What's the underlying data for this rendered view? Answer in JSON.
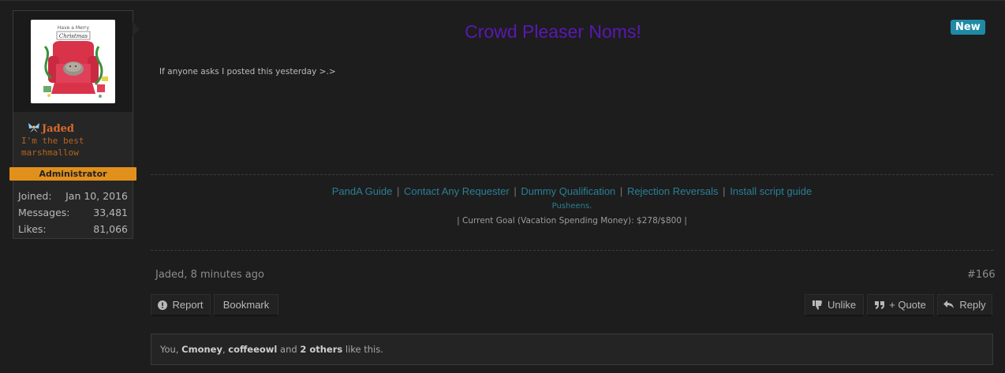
{
  "user": {
    "name": "Jaded",
    "custom_title": "I'm the best marshmallow",
    "role": "Administrator",
    "avatar_text": "Have a Merry Christmas",
    "stats": [
      {
        "label": "Joined:",
        "value": "Jan 10, 2016"
      },
      {
        "label": "Messages:",
        "value": "33,481"
      },
      {
        "label": "Likes:",
        "value": "81,066"
      }
    ]
  },
  "post": {
    "badge": "New",
    "title": "Crowd Pleaser Noms!",
    "body": "If anyone asks I posted this yesterday >.>",
    "signature": {
      "links": [
        "PandA Guide",
        "Contact Any Requester",
        "Dummy Qualification",
        "Rejection Reversals",
        "Install script guide"
      ],
      "separator": "|",
      "sub": "Pusheens.",
      "goal": "| Current Goal (Vacation Spending Money): $278/$800 |"
    },
    "meta": {
      "author_time": "Jaded, 8 minutes ago",
      "post_number": "#166"
    }
  },
  "actions": {
    "report": "Report",
    "bookmark": "Bookmark",
    "unlike": "Unlike",
    "quote": "+ Quote",
    "reply": "Reply"
  },
  "likes": {
    "prefix": "You, ",
    "user1": "Cmoney",
    "comma": ", ",
    "user2": "coffeeowl",
    "and": " and ",
    "others": "2 others",
    "suffix": " like this."
  },
  "colors": {
    "title": "#5a18b4",
    "username": "#d86a2b",
    "role_ribbon": "#e2901c",
    "badge": "#1f8aa6",
    "link": "#2a7f96"
  }
}
